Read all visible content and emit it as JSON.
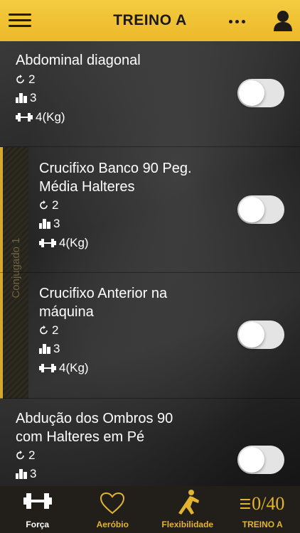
{
  "header": {
    "title": "TREINO A"
  },
  "exercises": [
    {
      "name_line1": "Abdominal diagonal",
      "name_line2": "",
      "reps": "2",
      "sets": "3",
      "weight": "4(Kg)"
    },
    {
      "name_line1": "Crucifixo Banco 90 Peg.",
      "name_line2": "Média Halteres",
      "reps": "2",
      "sets": "3",
      "weight": "4(Kg)"
    },
    {
      "name_line1": "Crucifixo Anterior na",
      "name_line2": "máquina",
      "reps": "2",
      "sets": "3",
      "weight": "4(Kg)"
    },
    {
      "name_line1": "Abdução dos Ombros 90",
      "name_line2": "com Halteres em Pé",
      "reps": "2",
      "sets": "3",
      "weight": ""
    }
  ],
  "conjugado_label": "Conjugado 1",
  "nav": {
    "forca": "Força",
    "aerobio": "Aeróbio",
    "flexibilidade": "Flexibilidade",
    "counter": "0/40",
    "treino": "TREINO A"
  },
  "colors": {
    "accent": "#ecb929",
    "nav_bg": "#221f1a",
    "nav_gold": "#e2b431"
  }
}
